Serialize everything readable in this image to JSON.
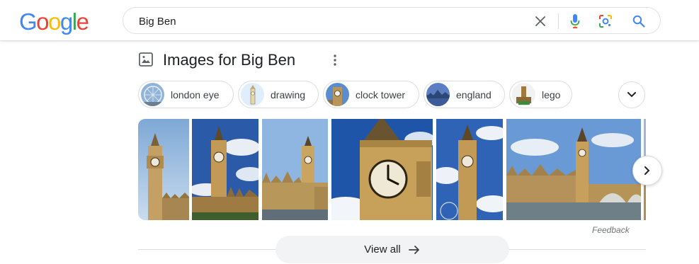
{
  "header": {
    "logo_letters": [
      "G",
      "o",
      "o",
      "g",
      "l",
      "e"
    ],
    "search": {
      "value": "Big Ben"
    },
    "icons": [
      "clear-icon",
      "mic-icon",
      "lens-icon",
      "search-icon"
    ]
  },
  "section": {
    "title": "Images for Big Ben",
    "icon": "image-icon"
  },
  "chips": [
    {
      "label": "london eye"
    },
    {
      "label": "drawing"
    },
    {
      "label": "clock tower"
    },
    {
      "label": "england"
    },
    {
      "label": "lego"
    }
  ],
  "images": {
    "count": 7
  },
  "feedback": "Feedback",
  "view_all": "View all",
  "colors": {
    "google_blue": "#4285F4",
    "google_red": "#EA4335",
    "google_yellow": "#FBBC05",
    "google_green": "#34A853",
    "border": "#dadce0",
    "sky": "#3b6db5",
    "stone": "#c9a463"
  }
}
